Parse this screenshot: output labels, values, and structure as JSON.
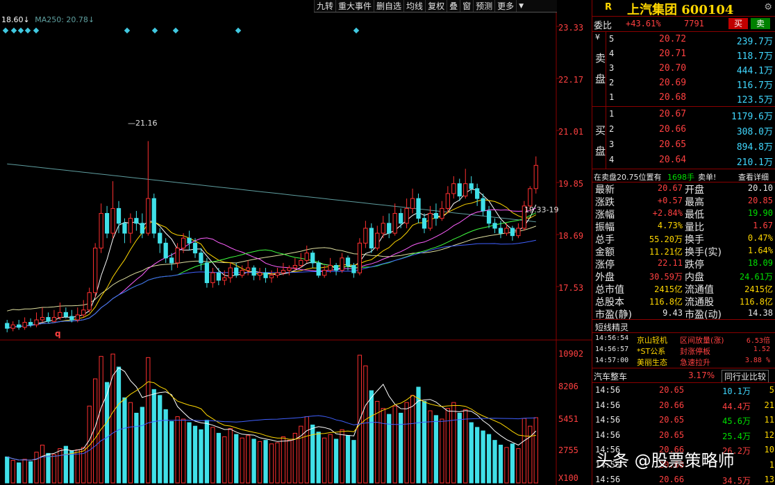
{
  "toolbar": [
    "九转",
    "重大事件",
    "删自选",
    "均线",
    "复权",
    "叠",
    "窗",
    "预测",
    "更多"
  ],
  "legend": {
    "price": "18.60↓",
    "ma": "MA250: 20.78↓"
  },
  "price_axis": [
    "23.33",
    "22.17",
    "21.01",
    "19.85",
    "18.69",
    "17.53"
  ],
  "volume_axis": [
    "10902",
    "8206",
    "5451",
    "2755",
    "X100"
  ],
  "annotations": {
    "high_label": "21.16",
    "right_label": "19.33-19",
    "low_marker": "q"
  },
  "chart_data": {
    "type": "candlestick",
    "price_range": [
      17.2,
      23.7
    ],
    "volume_range": [
      0,
      11500
    ],
    "candles": [
      [
        17.48,
        17.38,
        17.55,
        17.3,
        2200
      ],
      [
        17.38,
        17.45,
        17.52,
        17.32,
        1900
      ],
      [
        17.45,
        17.4,
        17.55,
        17.35,
        1700
      ],
      [
        17.4,
        17.5,
        17.6,
        17.35,
        2000
      ],
      [
        17.5,
        17.45,
        17.58,
        17.4,
        1800
      ],
      [
        17.45,
        17.55,
        17.7,
        17.4,
        2600
      ],
      [
        17.55,
        17.6,
        17.8,
        17.5,
        3200
      ],
      [
        17.6,
        17.52,
        17.7,
        17.48,
        2500
      ],
      [
        17.52,
        17.6,
        17.75,
        17.5,
        2400
      ],
      [
        17.6,
        17.7,
        17.9,
        17.55,
        2900
      ],
      [
        17.7,
        17.62,
        17.8,
        17.58,
        3100
      ],
      [
        17.62,
        17.55,
        17.75,
        17.5,
        2700
      ],
      [
        17.55,
        17.65,
        17.8,
        17.5,
        2800
      ],
      [
        17.65,
        17.75,
        17.95,
        17.6,
        3000
      ],
      [
        17.75,
        18.1,
        18.2,
        17.7,
        6500
      ],
      [
        18.1,
        19.0,
        19.1,
        18.0,
        8800
      ],
      [
        19.0,
        19.7,
        19.9,
        18.9,
        10700
      ],
      [
        19.7,
        19.3,
        19.85,
        19.2,
        8500
      ],
      [
        19.3,
        19.8,
        20.35,
        19.2,
        10902
      ],
      [
        19.8,
        19.5,
        19.95,
        19.3,
        9800
      ],
      [
        19.5,
        19.3,
        19.6,
        19.1,
        7200
      ],
      [
        19.3,
        19.6,
        19.7,
        19.1,
        6800
      ],
      [
        19.6,
        19.5,
        19.75,
        19.35,
        5900
      ],
      [
        19.5,
        19.3,
        19.7,
        19.2,
        6400
      ],
      [
        19.3,
        20.0,
        21.16,
        19.25,
        10600
      ],
      [
        20.0,
        19.3,
        20.1,
        19.2,
        7900
      ],
      [
        19.3,
        19.1,
        19.4,
        18.9,
        7400
      ],
      [
        19.1,
        18.8,
        19.2,
        18.7,
        6200
      ],
      [
        18.8,
        18.7,
        18.9,
        18.55,
        5200
      ],
      [
        18.7,
        19.0,
        19.1,
        18.6,
        5600
      ],
      [
        19.0,
        19.2,
        19.3,
        18.9,
        5400
      ],
      [
        19.2,
        19.1,
        19.35,
        18.95,
        5100
      ],
      [
        19.1,
        18.9,
        19.2,
        18.8,
        4800
      ],
      [
        18.9,
        18.7,
        19.0,
        18.55,
        4500
      ],
      [
        18.7,
        18.3,
        18.8,
        18.2,
        5300
      ],
      [
        18.3,
        18.5,
        18.6,
        18.2,
        4700
      ],
      [
        18.5,
        18.35,
        18.6,
        18.25,
        4200
      ],
      [
        18.35,
        18.4,
        18.55,
        18.25,
        3900
      ],
      [
        18.4,
        18.6,
        18.7,
        18.3,
        4600
      ],
      [
        18.6,
        18.45,
        18.7,
        18.4,
        4100
      ],
      [
        18.45,
        18.55,
        18.65,
        18.4,
        3800
      ],
      [
        18.55,
        18.6,
        18.75,
        18.45,
        4000
      ],
      [
        18.6,
        18.45,
        18.65,
        18.35,
        3700
      ],
      [
        18.45,
        18.5,
        18.6,
        18.35,
        3500
      ],
      [
        18.5,
        18.4,
        18.6,
        18.3,
        3600
      ],
      [
        18.4,
        18.45,
        18.55,
        18.3,
        3300
      ],
      [
        18.45,
        18.5,
        18.6,
        18.4,
        3400
      ],
      [
        18.5,
        18.55,
        18.7,
        18.45,
        3900
      ],
      [
        18.55,
        18.6,
        18.65,
        18.45,
        3600
      ],
      [
        18.6,
        18.65,
        18.8,
        18.55,
        4200
      ],
      [
        18.65,
        18.75,
        18.9,
        18.6,
        4800
      ],
      [
        18.75,
        18.9,
        19.05,
        18.7,
        5600
      ],
      [
        18.9,
        18.7,
        18.95,
        18.6,
        4900
      ],
      [
        18.7,
        18.45,
        18.75,
        18.4,
        4300
      ],
      [
        18.45,
        18.55,
        18.65,
        18.4,
        3800
      ],
      [
        18.55,
        18.65,
        18.8,
        18.5,
        4100
      ],
      [
        18.65,
        18.55,
        18.7,
        18.45,
        3700
      ],
      [
        18.55,
        18.8,
        18.9,
        18.5,
        4500
      ],
      [
        18.8,
        18.65,
        18.85,
        18.55,
        4000
      ],
      [
        18.65,
        18.5,
        18.7,
        18.4,
        3600
      ],
      [
        18.5,
        19.1,
        19.2,
        18.45,
        10800
      ],
      [
        19.1,
        19.4,
        19.55,
        19.0,
        9900
      ],
      [
        19.4,
        19.0,
        19.5,
        18.9,
        7800
      ],
      [
        19.0,
        19.3,
        19.45,
        18.95,
        6900
      ],
      [
        19.3,
        19.5,
        19.65,
        19.2,
        6300
      ],
      [
        19.5,
        19.3,
        19.7,
        19.2,
        5800
      ],
      [
        19.3,
        19.7,
        19.9,
        19.25,
        6500
      ],
      [
        19.7,
        19.5,
        19.8,
        19.4,
        5900
      ],
      [
        19.5,
        19.8,
        20.0,
        19.4,
        6800
      ],
      [
        19.8,
        20.0,
        20.2,
        19.7,
        7400
      ],
      [
        20.0,
        19.6,
        20.1,
        19.5,
        8100
      ],
      [
        19.6,
        19.4,
        19.7,
        19.3,
        6900
      ],
      [
        19.4,
        19.7,
        19.85,
        19.35,
        6100
      ],
      [
        19.7,
        19.6,
        19.9,
        19.45,
        5700
      ],
      [
        19.6,
        19.8,
        19.95,
        19.55,
        5400
      ],
      [
        19.8,
        20.1,
        20.25,
        19.7,
        6300
      ],
      [
        20.1,
        20.3,
        20.45,
        20.0,
        6800
      ],
      [
        20.3,
        20.05,
        20.4,
        19.95,
        5900
      ],
      [
        20.05,
        20.3,
        20.6,
        20.0,
        6200
      ],
      [
        20.3,
        20.2,
        20.45,
        20.1,
        5100
      ],
      [
        20.2,
        20.0,
        20.3,
        19.85,
        4700
      ],
      [
        20.0,
        19.75,
        20.1,
        19.65,
        4400
      ],
      [
        19.75,
        19.5,
        19.85,
        19.4,
        4100
      ],
      [
        19.5,
        19.4,
        19.6,
        19.3,
        3600
      ],
      [
        19.4,
        19.3,
        19.55,
        19.2,
        3200
      ],
      [
        19.3,
        19.4,
        19.5,
        19.25,
        3000
      ],
      [
        19.4,
        19.25,
        19.45,
        19.15,
        3300
      ],
      [
        19.25,
        19.4,
        19.5,
        19.2,
        2900
      ],
      [
        19.4,
        19.85,
        19.95,
        19.35,
        5451
      ],
      [
        19.85,
        20.2,
        20.25,
        19.75,
        4800
      ],
      [
        20.2,
        20.67,
        20.85,
        20.1,
        5520
      ]
    ]
  },
  "panel": {
    "r": "R",
    "title": "上汽集团 600104",
    "weibi_label": "委比",
    "weibi_pct": "+43.61%",
    "weibi_diff": "7791",
    "buy_btn": "买",
    "sell_btn": "卖",
    "sell_side_label": "卖盘",
    "yen": "¥",
    "asks": [
      {
        "lvl": "5",
        "price": "20.72",
        "vol": "239.7万"
      },
      {
        "lvl": "4",
        "price": "20.71",
        "vol": "118.7万"
      },
      {
        "lvl": "3",
        "price": "20.70",
        "vol": "444.1万"
      },
      {
        "lvl": "2",
        "price": "20.69",
        "vol": "116.7万"
      },
      {
        "lvl": "1",
        "price": "20.68",
        "vol": "123.5万"
      }
    ],
    "buy_side_label": "买盘",
    "bids": [
      {
        "lvl": "1",
        "price": "20.67",
        "vol": "1179.6万"
      },
      {
        "lvl": "2",
        "price": "20.66",
        "vol": "308.0万"
      },
      {
        "lvl": "3",
        "price": "20.65",
        "vol": "894.8万"
      },
      {
        "lvl": "4",
        "price": "20.64",
        "vol": "210.1万"
      }
    ],
    "notice_left": "在卖盘20.75位置有",
    "notice_vol": "1698手",
    "notice_right": "卖单!",
    "notice_link": "查看详细",
    "stats": [
      {
        "l1": "最新",
        "v1": "20.67",
        "c1": "red",
        "l2": "开盘",
        "v2": "20.10",
        "c2": "white"
      },
      {
        "l1": "涨跌",
        "v1": "+0.57",
        "c1": "red",
        "l2": "最高",
        "v2": "20.85",
        "c2": "red"
      },
      {
        "l1": "涨幅",
        "v1": "+2.84%",
        "c1": "red",
        "l2": "最低",
        "v2": "19.90",
        "c2": "green"
      },
      {
        "l1": "振幅",
        "v1": "4.73%",
        "c1": "yellow",
        "l2": "量比",
        "v2": "1.67",
        "c2": "red"
      },
      {
        "l1": "总手",
        "v1": "55.20万",
        "c1": "yellow",
        "l2": "换手",
        "v2": "0.47%",
        "c2": "yellow"
      },
      {
        "l1": "金额",
        "v1": "11.21亿",
        "c1": "yellow",
        "l2": "换手(实)",
        "v2": "1.64%",
        "c2": "yellow"
      },
      {
        "l1": "涨停",
        "v1": "22.11",
        "c1": "red",
        "l2": "跌停",
        "v2": "18.09",
        "c2": "green"
      },
      {
        "l1": "外盘",
        "v1": "30.59万",
        "c1": "red",
        "l2": "内盘",
        "v2": "24.61万",
        "c2": "green"
      },
      {
        "l1": "总市值",
        "v1": "2415亿",
        "c1": "yellow",
        "l2": "流通值",
        "v2": "2415亿",
        "c2": "yellow"
      },
      {
        "l1": "总股本",
        "v1": "116.8亿",
        "c1": "yellow",
        "l2": "流通股",
        "v2": "116.8亿",
        "c2": "yellow"
      },
      {
        "l1": "市盈(静)",
        "v1": "9.43",
        "c1": "white",
        "l2": "市盈(动)",
        "v2": "14.38",
        "c2": "white"
      }
    ],
    "short_title": "短线精灵",
    "shorts": [
      {
        "time": "14:56:54",
        "name": "京山轻机",
        "event": "区间放量(涨)",
        "val": "6.53倍"
      },
      {
        "time": "14:56:57",
        "name": "*ST公系",
        "event": "封涨停板",
        "val": "1.52"
      },
      {
        "time": "14:57:00",
        "name": "美丽生态",
        "event": "急速拉升",
        "val": "3.88 %"
      }
    ],
    "industry_name": "汽车整车",
    "industry_pct": "3.17%",
    "industry_btn": "同行业比较",
    "ticks": [
      {
        "time": "14:56",
        "price": "20.65",
        "vol": "10.1万",
        "vc": "cyan",
        "n": "5"
      },
      {
        "time": "14:56",
        "price": "20.66",
        "vol": "44.4万",
        "vc": "red",
        "n": "21"
      },
      {
        "time": "14:56",
        "price": "20.65",
        "vol": "45.6万",
        "vc": "green",
        "n": "11"
      },
      {
        "time": "14:56",
        "price": "20.65",
        "vol": "25.4万",
        "vc": "green",
        "n": "12"
      },
      {
        "time": "14:56",
        "price": "20.66",
        "vol": "26.2万",
        "vc": "red",
        "n": "10"
      },
      {
        "time": "14:56",
        "price": "20.66",
        "vol": "",
        "vc": "red",
        "n": "1"
      },
      {
        "time": "14:56",
        "price": "20.66",
        "vol": "34.5万",
        "vc": "red",
        "n": "13"
      }
    ]
  },
  "watermark": "头条 @股票策略师"
}
